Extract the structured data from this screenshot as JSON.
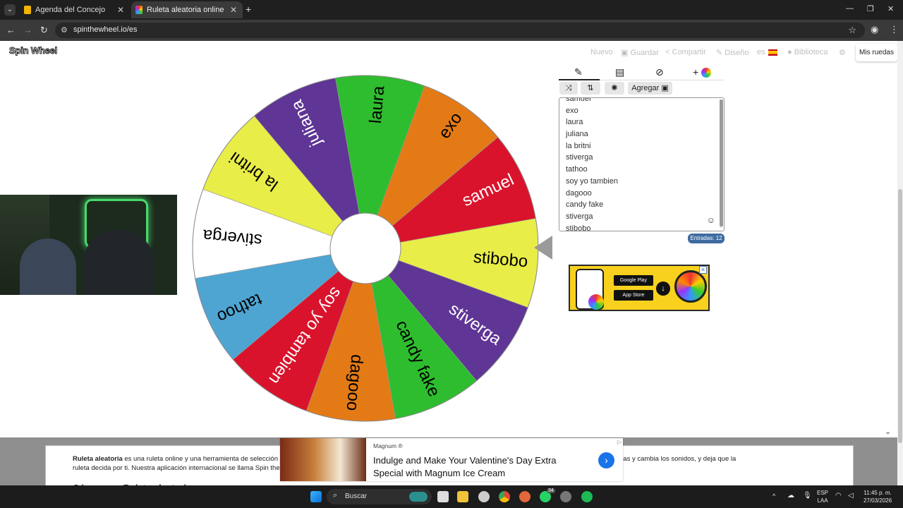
{
  "browser": {
    "tabs": [
      {
        "title": "Agenda del Concejo",
        "active": false
      },
      {
        "title": "Ruleta aleatoria online – ruleta",
        "active": true
      }
    ],
    "url": "spinthewheel.io/es"
  },
  "site": {
    "logo": "Spin Wheel",
    "nav": {
      "nuevo": "Nuevo",
      "guardar": "Guardar",
      "compartir": "Compartir",
      "diseno": "Diseño",
      "lang": "es",
      "biblioteca": "Biblioteca",
      "mis_ruedas": "Mis ruedas"
    }
  },
  "wheel": {
    "segments": [
      {
        "label": "stibobo",
        "color": "#e8ed48",
        "text_color": "#000000"
      },
      {
        "label": "stiverga",
        "color": "#5f3595",
        "text_color": "#ffffff"
      },
      {
        "label": "candy fake",
        "color": "#2ebd2e",
        "text_color": "#000000"
      },
      {
        "label": "dagooo",
        "color": "#e47a16",
        "text_color": "#000000"
      },
      {
        "label": "soy yo tambien",
        "color": "#d9132c",
        "text_color": "#ffffff"
      },
      {
        "label": "tathoo",
        "color": "#4ea5d2",
        "text_color": "#000000"
      },
      {
        "label": "stiverga",
        "color": "#ffffff",
        "text_color": "#000000"
      },
      {
        "label": "la britni",
        "color": "#e8ed48",
        "text_color": "#000000"
      },
      {
        "label": "juliana",
        "color": "#5f3595",
        "text_color": "#ffffff"
      },
      {
        "label": "laura",
        "color": "#2ebd2e",
        "text_color": "#000000"
      },
      {
        "label": "exo",
        "color": "#e47a16",
        "text_color": "#000000"
      },
      {
        "label": "samuel",
        "color": "#d9132c",
        "text_color": "#ffffff"
      }
    ]
  },
  "editor": {
    "tabs": [
      "edit-icon",
      "clipboard-icon",
      "hide-icon",
      "add-color-icon"
    ],
    "actions": {
      "agregar": "Agregar"
    },
    "entries": [
      "samuel",
      "exo",
      "laura",
      "juliana",
      "la britni",
      "stiverga",
      "tathoo",
      "soy yo tambien",
      "dagooo",
      "candy fake",
      "stiverga",
      "stibobo"
    ],
    "count_label": "Entradas: 12"
  },
  "app_ad": {
    "google_play": "Google Play",
    "app_store": "App Store"
  },
  "content": {
    "title_bold": "Ruleta aleatoria",
    "desc_part1": " es una ruleta online y una herramienta de selección al a",
    "desc_part2": "propias entradas, aplica temas y cambia los sonidos, y deja que la",
    "desc_line2": "ruleta decida por ti. Nuestra aplicación internacional se llama Spin the V",
    "howto": "Cómo usar Ruleta aleatoria"
  },
  "magnum_ad": {
    "brand": "Magnum ®",
    "headline": "Indulge and Make Your Valentine's Day Extra Special with Magnum Ice Cream"
  },
  "taskbar": {
    "search": "Buscar",
    "lang": "ESP",
    "lang2": "LAA",
    "time": "11:45 p. m.",
    "date": "27/03/2026",
    "whatsapp_badge": "34"
  }
}
